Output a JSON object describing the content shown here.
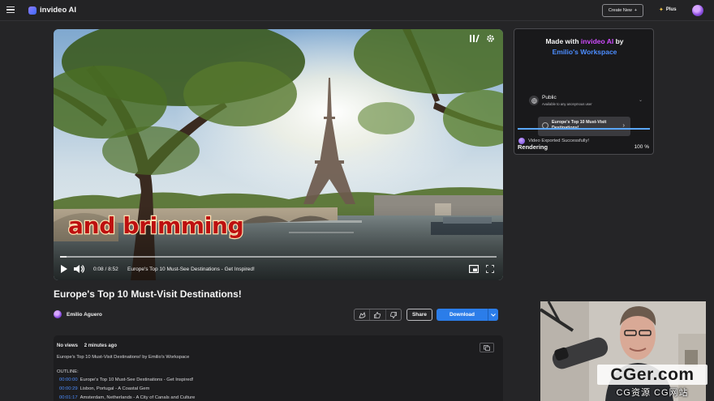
{
  "app": {
    "name": "invideo AI"
  },
  "header": {
    "create_label": "Create New",
    "plan_label": "Plus"
  },
  "player": {
    "caption": "and brimming",
    "time": "0:08 / 8:52",
    "chapter": "Europe's Top 10 Must-See Destinations - Get Inspired!",
    "progress": 0.015
  },
  "status": {
    "made_with_prefix": "Made with",
    "made_with_brand": "invideo AI",
    "made_with_suffix": "by",
    "workspace": "Emilio's Workspace",
    "privacy_title": "Public",
    "privacy_sub": "Available to any anonymous user",
    "video_name": "Europe's Top 10 Must-Visit Destinations!",
    "rendering_label": "Rendering",
    "rendering_pct": "100 %",
    "rendering_progress": 1.0,
    "export_msg": "Video Exported Successfully!"
  },
  "video": {
    "title": "Europe's Top 10 Must-Visit Destinations!",
    "author": "Emilio Aguero",
    "share_label": "Share",
    "download_label": "Download"
  },
  "description": {
    "views": "No views",
    "age": "2 minutes ago",
    "line": "Europe's Top 10 Must-Visit Destinations! by Emilio's Workspace",
    "outline_label": "OUTLINE:",
    "chapters": [
      {
        "ts": "00:00:00",
        "title": "Europe's Top 10 Must-See Destinations - Get Inspired!"
      },
      {
        "ts": "00:00:29",
        "title": "Lisbon, Portugal - A Coastal Gem"
      },
      {
        "ts": "00:01:17",
        "title": "Amsterdam, Netherlands - A City of Canals and Culture"
      }
    ]
  },
  "watermark": {
    "big": "CGer.com",
    "small": "CG资源 CG网站"
  },
  "colors": {
    "accent": "#2b7de9",
    "brand": "#cf4bff",
    "link": "#4c8dff",
    "caption": "#bd1010"
  }
}
